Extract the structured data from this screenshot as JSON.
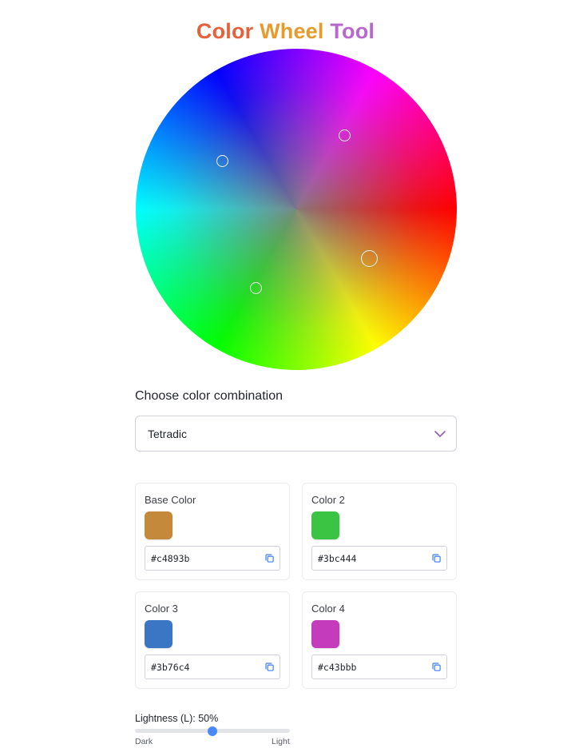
{
  "header": {
    "title_words": [
      {
        "text": "Color",
        "color": "#e8603a"
      },
      {
        "text": "Wheel",
        "color": "#e69b2c"
      },
      {
        "text": "Tool",
        "color": "#b867cf"
      }
    ]
  },
  "wheel": {
    "marker_hues": [
      34,
      117,
      213,
      303
    ],
    "base_hue": 34,
    "saturation_level": 0.55
  },
  "combination": {
    "label": "Choose color combination",
    "selected": "Tetradic",
    "chevron_color": "#9b59b6"
  },
  "colors": [
    {
      "label": "Base Color",
      "hex": "#c4893b"
    },
    {
      "label": "Color 2",
      "hex": "#3bc444"
    },
    {
      "label": "Color 3",
      "hex": "#3b76c4"
    },
    {
      "label": "Color 4",
      "hex": "#c43bbb"
    }
  ],
  "copy_icon_color": "#4a89f5",
  "lightness": {
    "label": "Lightness (L): 50%",
    "value_percent": 50,
    "min_label": "Dark",
    "max_label": "Light"
  }
}
